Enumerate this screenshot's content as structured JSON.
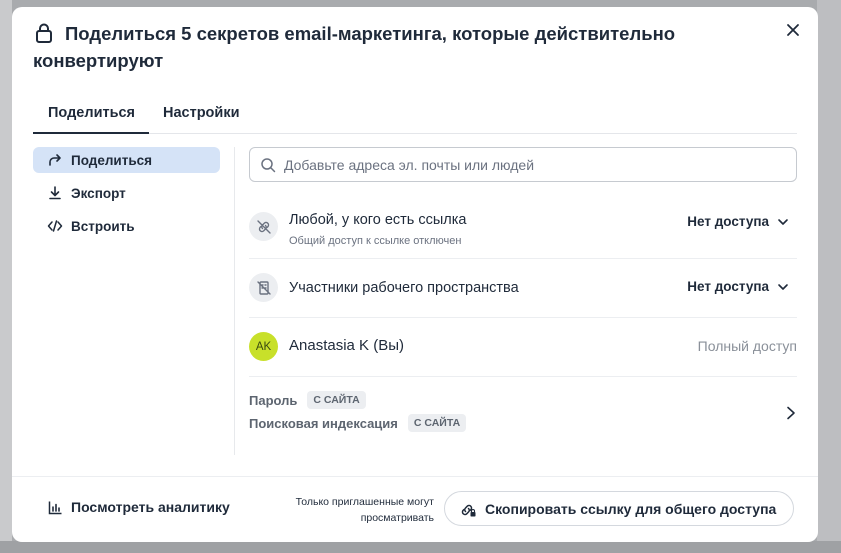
{
  "modal": {
    "title": "Поделиться 5 секретов email-маркетинга, которые действительно конвертируют"
  },
  "tabs": [
    {
      "label": "Поделиться",
      "active": true
    },
    {
      "label": "Настройки",
      "active": false
    }
  ],
  "sidebar": {
    "items": [
      {
        "label": "Поделиться",
        "icon": "share-arrow-icon",
        "active": true
      },
      {
        "label": "Экспорт",
        "icon": "download-icon",
        "active": false
      },
      {
        "label": "Встроить",
        "icon": "code-icon",
        "active": false
      }
    ]
  },
  "search": {
    "placeholder": "Добавьте адреса эл. почты или людей",
    "value": ""
  },
  "access_rows": [
    {
      "title": "Любой, у кого есть ссылка",
      "subtitle": "Общий доступ к ссылке отключен",
      "access": "Нет доступа",
      "icon": "link-off-icon"
    },
    {
      "title": "Участники рабочего пространства",
      "access": "Нет доступа",
      "icon": "workspace-off-icon"
    }
  ],
  "user": {
    "initials": "AK",
    "name": "Anastasia K (Вы)",
    "access": "Полный доступ"
  },
  "site_settings": {
    "password_label": "Пароль",
    "password_badge": "С САЙТА",
    "indexing_label": "Поисковая индексация",
    "indexing_badge": "С САЙТА"
  },
  "footer": {
    "analytics_label": "Посмотреть аналитику",
    "note": "Только приглашенные могут просматривать",
    "copy_label": "Скопировать ссылку для общего доступа"
  },
  "colors": {
    "accent_active_bg": "#d5e3f7",
    "avatar_bg": "#c8e02a",
    "text_primary": "#1f2a3a"
  }
}
